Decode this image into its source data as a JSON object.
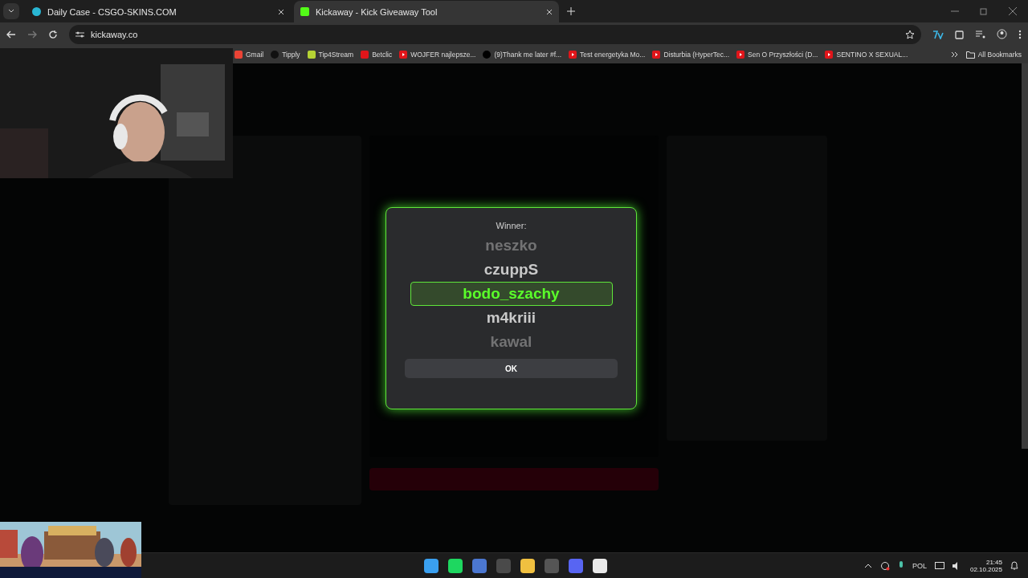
{
  "browser": {
    "tabs": [
      {
        "title": "Daily Case - CSGO-SKINS.COM",
        "selected": false
      },
      {
        "title": "Kickaway - Kick Giveaway Tool",
        "selected": true
      }
    ],
    "address": "kickaway.co",
    "bookmarks": [
      {
        "label": "Gmail",
        "kind": "gmail"
      },
      {
        "label": "Tipply",
        "kind": "tipply"
      },
      {
        "label": "Tip4Stream",
        "kind": "tip4stream"
      },
      {
        "label": "Betclic",
        "kind": "betclic"
      },
      {
        "label": "WOJFER najlepsze...",
        "kind": "youtube"
      },
      {
        "label": "(9)Thank me later #f...",
        "kind": "tiktok"
      },
      {
        "label": "Test energetyka Mo...",
        "kind": "youtube"
      },
      {
        "label": "Disturbia (HyperTec...",
        "kind": "youtube"
      },
      {
        "label": "Sen O Przyszłości (D...",
        "kind": "youtube"
      },
      {
        "label": "SENTINO X SEXUAL...",
        "kind": "youtube"
      }
    ],
    "all_bookmarks": "All Bookmarks"
  },
  "modal": {
    "title": "Winner:",
    "names": [
      {
        "name": "neszko",
        "selected": false
      },
      {
        "name": "czuppS",
        "selected": false
      },
      {
        "name": "bodo_szachy",
        "selected": true
      },
      {
        "name": "m4kriii",
        "selected": false
      },
      {
        "name": "kawal",
        "selected": false
      }
    ],
    "ok": "OK"
  },
  "taskbar": {
    "language": "POL",
    "time": "21:45",
    "date": "02.10.2025"
  }
}
